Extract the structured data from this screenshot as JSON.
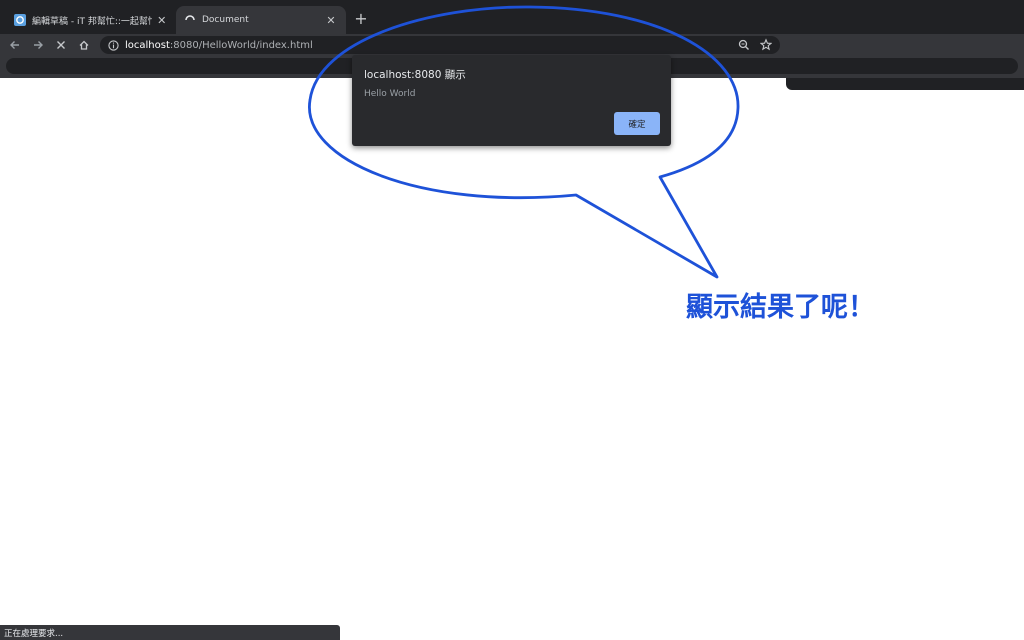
{
  "tabs": [
    {
      "title": "編輯草稿 - iT 邦幫忙::一起幫忙解",
      "icon": "ithome-favicon-icon",
      "active": false
    },
    {
      "title": "Document",
      "icon": "loading-spinner-icon",
      "active": true
    }
  ],
  "toolbar": {
    "url_host": "localhost",
    "url_path": ":8080/HelloWorld/index.html"
  },
  "dialog": {
    "title": "localhost:8080 顯示",
    "message": "Hello World",
    "ok_label": "確定"
  },
  "annotation": {
    "text": "顯示結果了呢！",
    "color": "#1e52d8"
  },
  "status_bar": {
    "text": "正在處理要求..."
  }
}
